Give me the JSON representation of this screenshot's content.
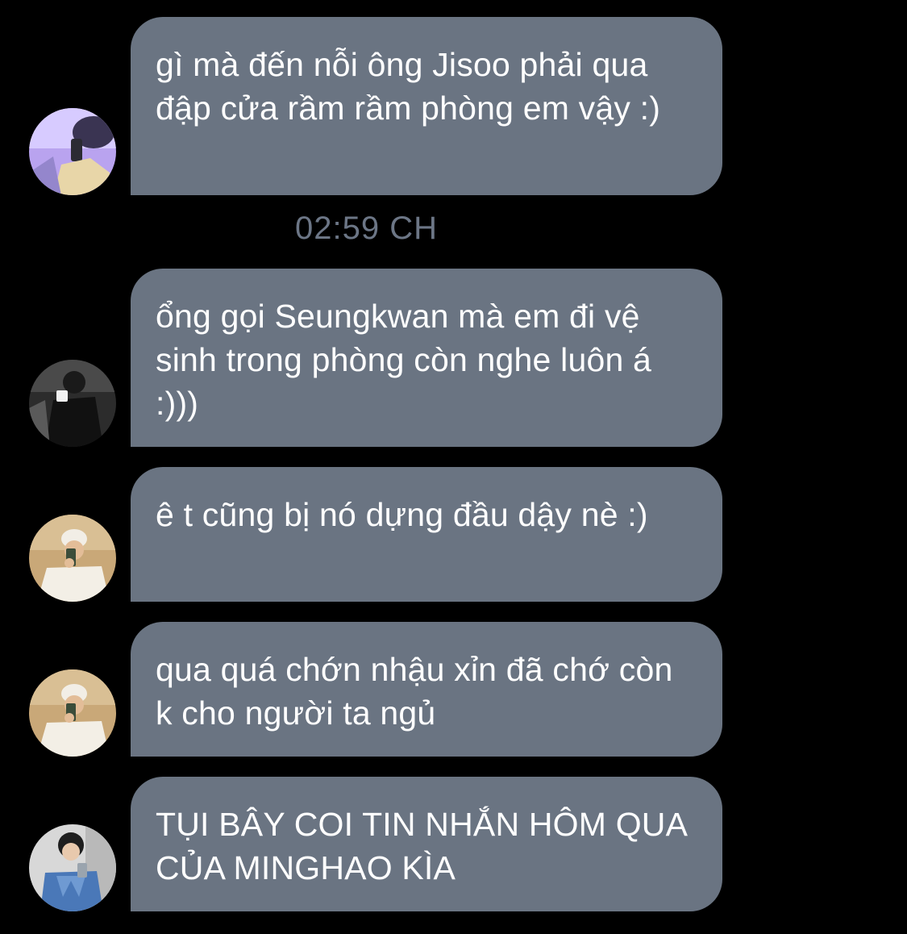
{
  "timestamp": "02:59 CH",
  "messages": [
    {
      "text": "gì mà đến nỗi ông Jisoo phải qua đập cửa rầm rầm phòng em vậy :)",
      "avatar": "avatar-purple-icon"
    },
    {
      "text": "ổng gọi Seungkwan mà em đi vệ sinh trong phòng còn nghe luôn á :)))",
      "avatar": "avatar-dark-icon"
    },
    {
      "text": "ê t cũng bị nó dựng đầu dậy nè :)",
      "avatar": "avatar-beanie-icon"
    },
    {
      "text": "qua quá chớn nhậu xỉn đã chớ còn k cho người ta ngủ",
      "avatar": "avatar-beanie-icon"
    },
    {
      "text": "TỤI BÂY COI TIN NHẮN HÔM QUA CỦA MINGHAO KÌA",
      "avatar": "avatar-denim-icon"
    }
  ],
  "colors": {
    "background": "#000000",
    "bubble": "#6a7482",
    "timestamp": "#6c7686"
  }
}
